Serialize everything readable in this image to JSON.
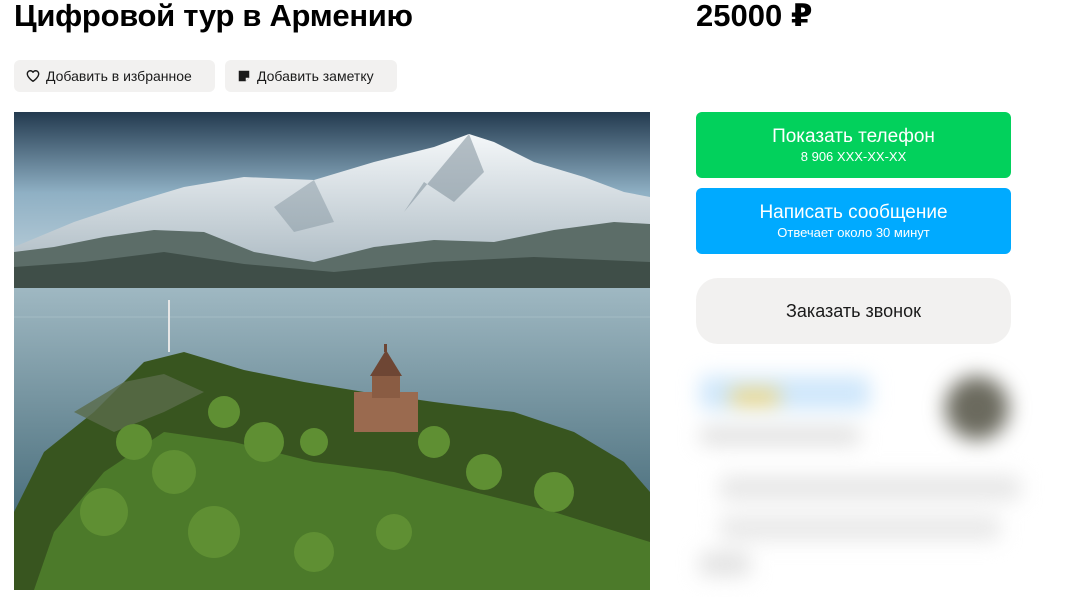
{
  "listing": {
    "title": "Цифровой тур в Армению",
    "price": "25000 ₽"
  },
  "actions": {
    "favorite_label": "Добавить в избранное",
    "note_label": "Добавить заметку"
  },
  "photo": {
    "alt": "Монастырь у озера на фоне заснеженных гор"
  },
  "contact": {
    "phone_label": "Показать телефон",
    "phone_masked": "8 906 ХХХ-ХХ-ХХ",
    "message_label": "Написать сообщение",
    "message_sub": "Отвечает около 30 минут",
    "call_label": "Заказать звонок"
  },
  "colors": {
    "phone_button": "#02d15c",
    "message_button": "#00aaff",
    "chip_background": "#f2f1f0"
  },
  "icons": {
    "favorite": "heart-icon",
    "note": "note-icon"
  }
}
